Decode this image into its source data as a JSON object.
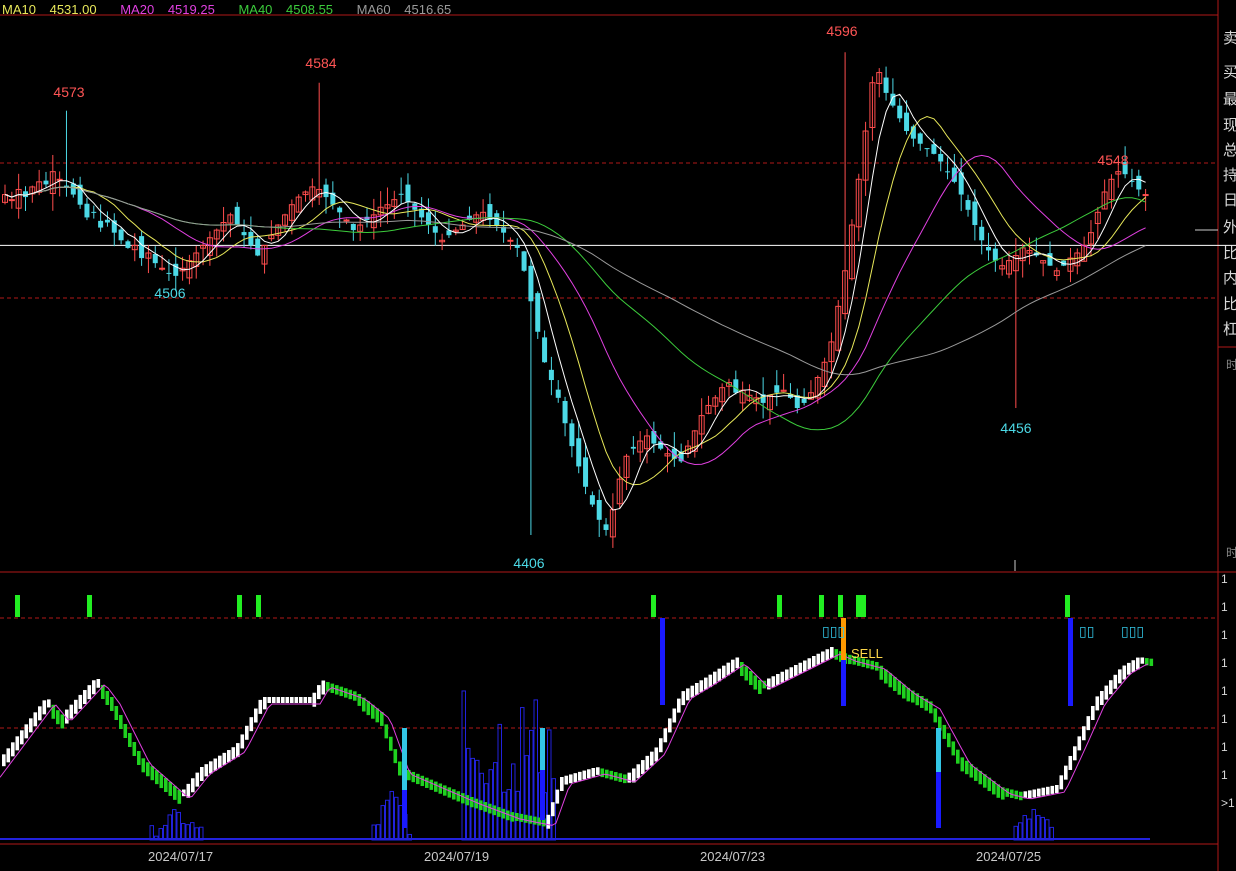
{
  "ma_legend": [
    {
      "label": "MA10",
      "value": "4531.00",
      "color": "#e8e85a"
    },
    {
      "label": "MA20",
      "value": "4519.25",
      "color": "#e040e0"
    },
    {
      "label": "MA40",
      "value": "4508.55",
      "color": "#3ccc3c"
    },
    {
      "label": "MA60",
      "value": "4516.65",
      "color": "#9a9a9a"
    }
  ],
  "side_panel": {
    "items": [
      "卖",
      "买",
      "最",
      "现",
      "总",
      "持",
      "日",
      "外",
      "比",
      "内",
      "比",
      "杠"
    ],
    "lower_items": [
      "时",
      "时"
    ],
    "tick_labels": [
      "1",
      "1",
      "1",
      "1",
      "1",
      "1",
      "1",
      "1",
      "1",
      ">1"
    ]
  },
  "x_axis_labels": [
    "2024/07/17",
    "2024/07/19",
    "2024/07/23",
    "2024/07/25"
  ],
  "price_annotations": [
    {
      "text": "4573",
      "kind": "high"
    },
    {
      "text": "4584",
      "kind": "high"
    },
    {
      "text": "4596",
      "kind": "high"
    },
    {
      "text": "4548",
      "kind": "high"
    },
    {
      "text": "4506",
      "kind": "low"
    },
    {
      "text": "4406",
      "kind": "low"
    },
    {
      "text": "4456",
      "kind": "low"
    }
  ],
  "signal_text": {
    "sell": "SELL",
    "box_glyphs": [
      "▯▯▯",
      "▯▯",
      "▯▯▯"
    ]
  },
  "colors": {
    "up": "#ff4d4d",
    "down": "#4cd9e6",
    "ma10": "#e8e85a",
    "ma20": "#e040e0",
    "ma40": "#3ccc3c",
    "ma60": "#9a9a9a",
    "axis_red": "#b01818",
    "high_label": "#ff5555",
    "low_label": "#4cd9e6",
    "signal_green": "#22ee22",
    "signal_blue": "#1a1aff",
    "signal_orange": "#ff9900",
    "vol_blue": "#2222dd"
  },
  "chart_data": [
    {
      "type": "candlestick",
      "title": "",
      "ma_periods": [
        10,
        20,
        40,
        60
      ],
      "ylim": [
        4395,
        4602
      ],
      "reference_levels": [
        4520
      ],
      "labeled_extremes": {
        "highs": [
          4573,
          4584,
          4596,
          4548
        ],
        "lows": [
          4506,
          4406,
          4456
        ]
      },
      "close": [
        4540,
        4538,
        4542,
        4539,
        4543,
        4545,
        4544,
        4549,
        4546,
        4543,
        4540,
        4536,
        4531,
        4533,
        4527,
        4529,
        4525,
        4522,
        4519,
        4520,
        4515,
        4517,
        4513,
        4511,
        4509,
        4508,
        4511,
        4514,
        4517,
        4520,
        4523,
        4526,
        4529,
        4532,
        4528,
        4524,
        4520,
        4516,
        4520,
        4524,
        4528,
        4532,
        4536,
        4539,
        4541,
        4543,
        4542,
        4539,
        4536,
        4533,
        4530,
        4526,
        4528,
        4530,
        4532,
        4535,
        4536,
        4538,
        4540,
        4537,
        4534,
        4531,
        4528,
        4525,
        4522,
        4524,
        4526,
        4528,
        4530,
        4532,
        4533,
        4530,
        4528,
        4525,
        4522,
        4519,
        4510,
        4498,
        4486,
        4474,
        4467,
        4460,
        4450,
        4441,
        4433,
        4425,
        4418,
        4412,
        4408,
        4416,
        4428,
        4437,
        4440,
        4443,
        4445,
        4442,
        4440,
        4438,
        4436,
        4435,
        4441,
        4447,
        4453,
        4457,
        4460,
        4464,
        4466,
        4462,
        4463,
        4461,
        4460,
        4458,
        4461,
        4462,
        4463,
        4460,
        4456,
        4458,
        4462,
        4468,
        4474,
        4482,
        4496,
        4510,
        4528,
        4546,
        4565,
        4584,
        4588,
        4580,
        4575,
        4570,
        4565,
        4562,
        4560,
        4558,
        4556,
        4553,
        4549,
        4545,
        4540,
        4534,
        4528,
        4522,
        4518,
        4514,
        4512,
        4514,
        4516,
        4519,
        4518,
        4516,
        4514,
        4512,
        4510,
        4512,
        4515,
        4517,
        4520,
        4525,
        4533,
        4541,
        4546,
        4549,
        4548,
        4545,
        4542,
        4540
      ]
    },
    {
      "type": "bar",
      "title": "",
      "series": [
        {
          "name": "",
          "kind": "line-steps"
        },
        {
          "name": "",
          "kind": "volume"
        }
      ]
    }
  ]
}
